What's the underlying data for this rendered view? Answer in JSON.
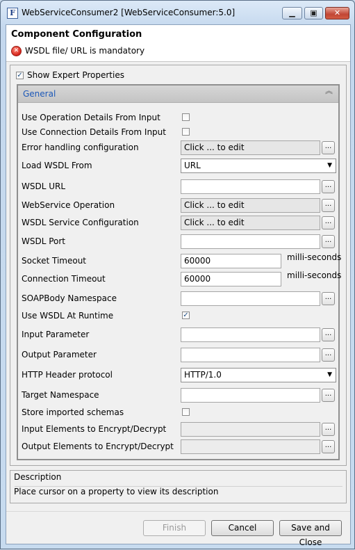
{
  "window": {
    "title": "WebServiceConsumer2 [WebServiceConsumer:5.0]",
    "app_icon_letter": "F",
    "min_glyph": "▁",
    "max_glyph": "▣",
    "close_glyph": "✕"
  },
  "header": {
    "title": "Component Configuration",
    "error_icon_glyph": "✕",
    "error_message": "WSDL file/ URL is mandatory"
  },
  "show_expert": {
    "label": "Show Expert Properties",
    "checked": true,
    "check_glyph": "✓"
  },
  "group": {
    "title": "General",
    "collapse_glyph": "︽"
  },
  "properties": [
    {
      "label": "Use Operation Details From Input",
      "type": "checkbox",
      "checked": false
    },
    {
      "label": "Use Connection Details From Input",
      "type": "checkbox",
      "checked": false
    },
    {
      "label": "Error handling configuration",
      "type": "editor",
      "value": "Click ... to edit",
      "button": "..."
    },
    {
      "label": "Load WSDL From",
      "type": "combo",
      "value": "URL",
      "arrow": "▼"
    },
    {
      "label": "WSDL URL",
      "type": "text",
      "value": "",
      "button": "..."
    },
    {
      "label": "WebService Operation",
      "type": "editor",
      "value": "Click ... to edit",
      "button": "..."
    },
    {
      "label": "WSDL Service Configuration",
      "type": "editor",
      "value": "Click ... to edit",
      "button": "..."
    },
    {
      "label": "WSDL Port",
      "type": "text",
      "value": "",
      "button": "..."
    },
    {
      "label": "Socket Timeout",
      "type": "number",
      "value": "60000",
      "unit": "milli-seconds"
    },
    {
      "label": "Connection Timeout",
      "type": "number",
      "value": "60000",
      "unit": "milli-seconds"
    },
    {
      "label": "SOAPBody Namespace",
      "type": "text",
      "value": "",
      "button": "..."
    },
    {
      "label": "Use WSDL At Runtime",
      "type": "checkbox",
      "checked": true,
      "check_glyph": "✓"
    },
    {
      "label": "Input Parameter",
      "type": "text",
      "value": "",
      "button": "..."
    },
    {
      "label": "Output Parameter",
      "type": "text",
      "value": "",
      "button": "..."
    },
    {
      "label": "HTTP Header protocol",
      "type": "combo",
      "value": "HTTP/1.0",
      "arrow": "▼"
    },
    {
      "label": "Target Namespace",
      "type": "text",
      "value": "",
      "button": "..."
    },
    {
      "label": "Store imported schemas",
      "type": "checkbox",
      "checked": false
    },
    {
      "label": "Input Elements to Encrypt/Decrypt",
      "type": "disabled",
      "value": "",
      "button": "..."
    },
    {
      "label": "Output Elements to Encrypt/Decrypt",
      "type": "disabled",
      "value": "",
      "button": "..."
    }
  ],
  "description": {
    "title": "Description",
    "text": "Place cursor on a property to view its description"
  },
  "buttons": {
    "finish": "Finish",
    "cancel": "Cancel",
    "save_close": "Save and Close"
  }
}
